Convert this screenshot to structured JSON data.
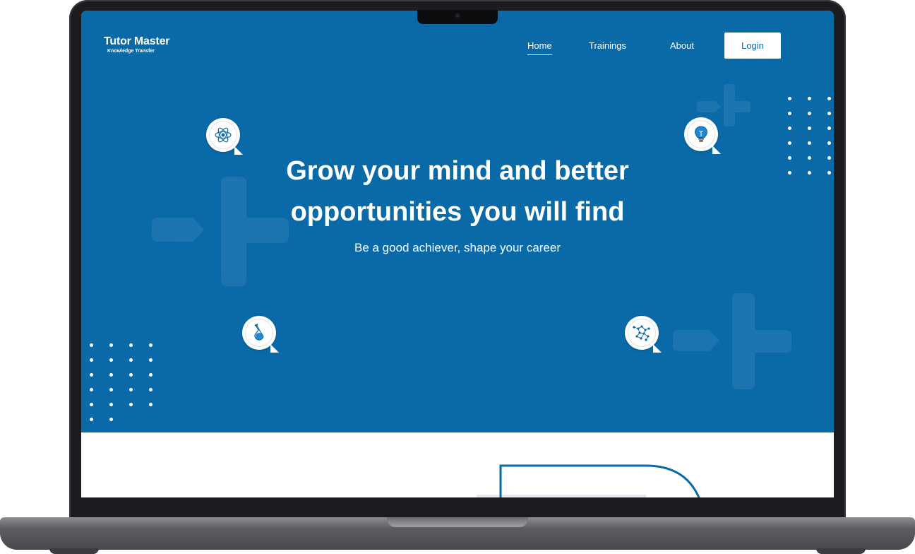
{
  "logo": {
    "title": "Tutor Master",
    "subtitle": "Knowledge Transfer"
  },
  "nav": {
    "items": [
      {
        "label": "Home",
        "active": true
      },
      {
        "label": "Trainings",
        "active": false
      },
      {
        "label": "About",
        "active": false
      }
    ],
    "login_label": "Login"
  },
  "hero": {
    "headline_line1": "Grow your mind and better",
    "headline_line2": "opportunities you will find",
    "subheadline": "Be a good achiever, shape your career",
    "background_color": "#0a6aa8",
    "icons": [
      "atom-icon",
      "lightbulb-icon",
      "flask-icon",
      "network-icon"
    ]
  },
  "colors": {
    "brand": "#0a6aa8",
    "text_on_brand": "#ffffff"
  }
}
